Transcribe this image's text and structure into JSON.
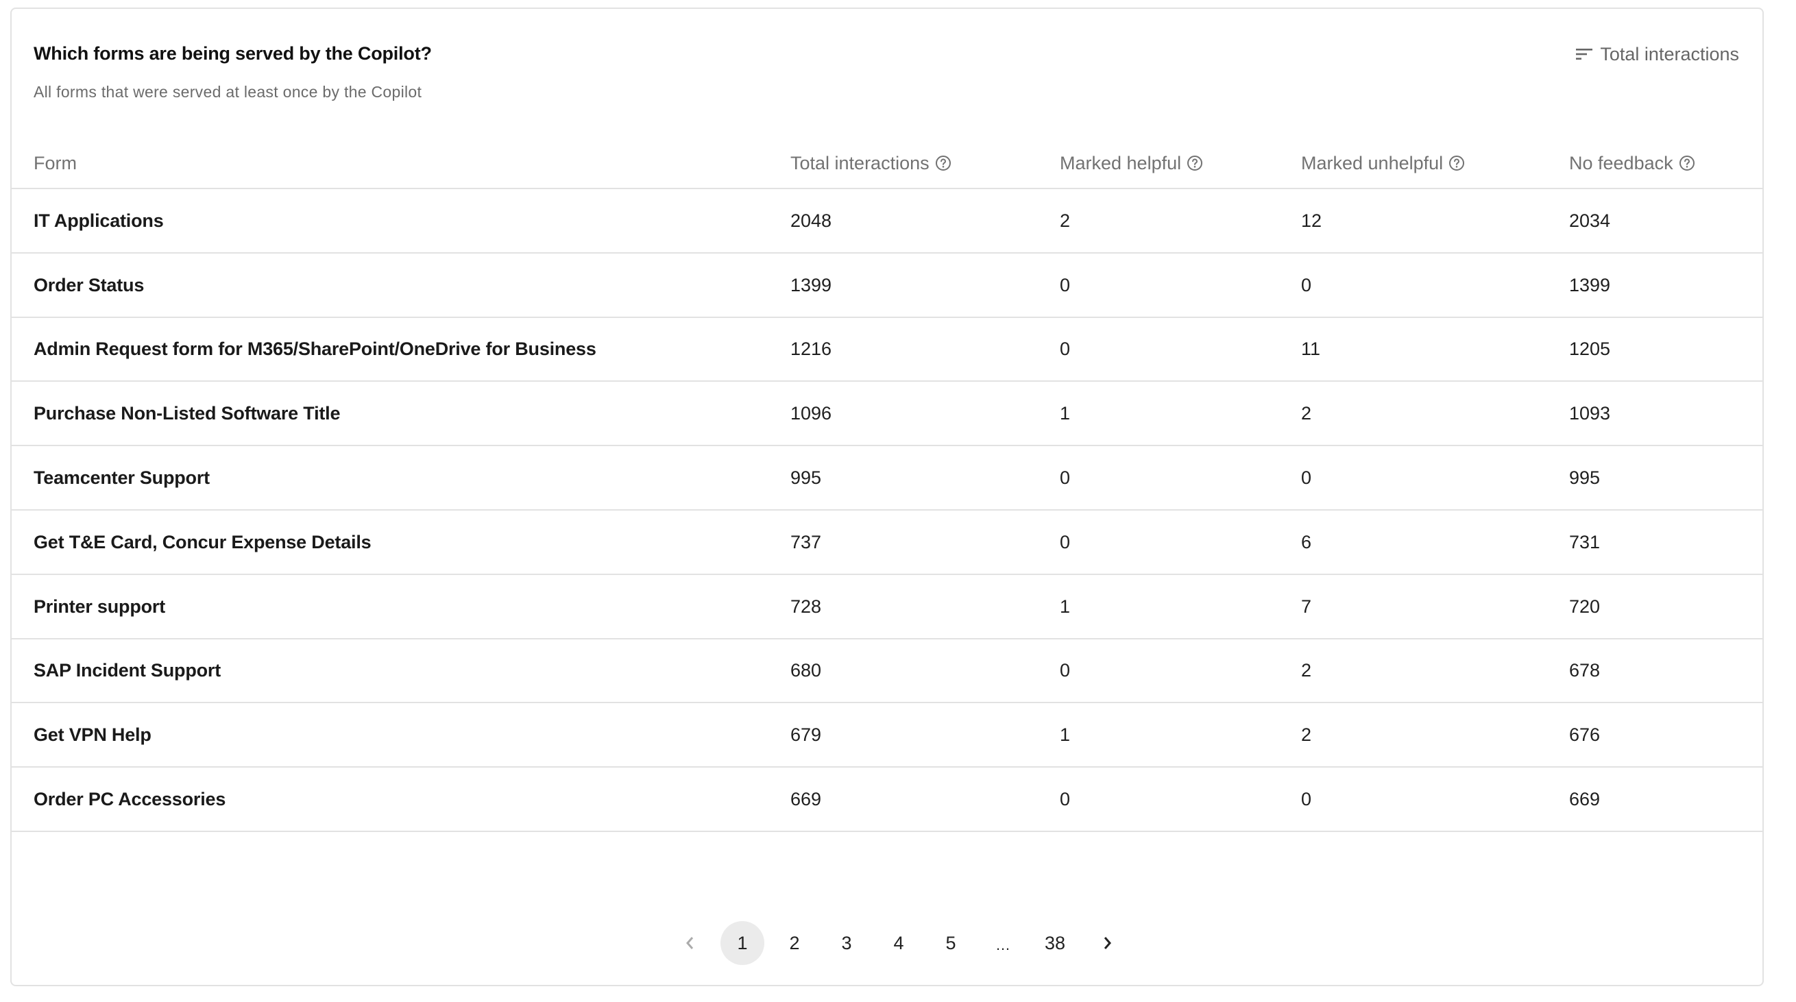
{
  "card": {
    "title": "Which forms are being served by the Copilot?",
    "subtitle": "All forms that were served at least once by the Copilot",
    "sort": {
      "icon": "sort-icon",
      "label": "Total interactions"
    }
  },
  "table": {
    "columns": [
      {
        "label": "Form",
        "help": false
      },
      {
        "label": "Total interactions",
        "help": true
      },
      {
        "label": "Marked helpful",
        "help": true
      },
      {
        "label": "Marked unhelpful",
        "help": true
      },
      {
        "label": "No feedback",
        "help": true
      }
    ],
    "rows": [
      {
        "form": "IT Applications",
        "total": "2048",
        "helpful": "2",
        "unhelpful": "12",
        "no_feedback": "2034"
      },
      {
        "form": "Order Status",
        "total": "1399",
        "helpful": "0",
        "unhelpful": "0",
        "no_feedback": "1399"
      },
      {
        "form": "Admin Request form for M365/SharePoint/OneDrive for Business",
        "total": "1216",
        "helpful": "0",
        "unhelpful": "11",
        "no_feedback": "1205"
      },
      {
        "form": "Purchase Non-Listed Software Title",
        "total": "1096",
        "helpful": "1",
        "unhelpful": "2",
        "no_feedback": "1093"
      },
      {
        "form": "Teamcenter Support",
        "total": "995",
        "helpful": "0",
        "unhelpful": "0",
        "no_feedback": "995"
      },
      {
        "form": "Get T&E Card, Concur Expense Details",
        "total": "737",
        "helpful": "0",
        "unhelpful": "6",
        "no_feedback": "731"
      },
      {
        "form": "Printer support",
        "total": "728",
        "helpful": "1",
        "unhelpful": "7",
        "no_feedback": "720"
      },
      {
        "form": "SAP Incident Support",
        "total": "680",
        "helpful": "0",
        "unhelpful": "2",
        "no_feedback": "678"
      },
      {
        "form": "Get VPN Help",
        "total": "679",
        "helpful": "1",
        "unhelpful": "2",
        "no_feedback": "676"
      },
      {
        "form": "Order PC Accessories",
        "total": "669",
        "helpful": "0",
        "unhelpful": "0",
        "no_feedback": "669"
      }
    ]
  },
  "pagination": {
    "current_page": "1",
    "pages": [
      "1",
      "2",
      "3",
      "4",
      "5",
      "…",
      "38"
    ],
    "prev_icon": "chevron-left-icon",
    "next_icon": "chevron-right-icon",
    "prev_disabled": true
  },
  "colors": {
    "border": "#e2e2e2",
    "active_page_bg": "#ebebeb",
    "muted_text": "#727272",
    "text": "#1f1f1f"
  }
}
